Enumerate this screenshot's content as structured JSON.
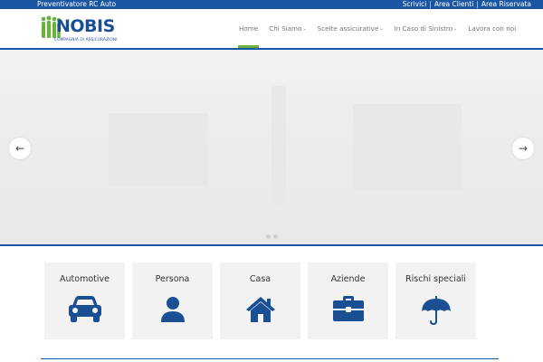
{
  "topbar": {
    "left_text": "Preventivatore RC Auto",
    "links": [
      {
        "label": "Scrivici"
      },
      {
        "label": "Area Clienti"
      },
      {
        "label": "Area Riservata"
      }
    ],
    "separator": "|"
  },
  "logo": {
    "wordmark": "NOBIS",
    "tagline": "COMPAGNIA DI ASSICURAZIONI"
  },
  "nav": {
    "items": [
      {
        "label": "Home",
        "has_dropdown": false
      },
      {
        "label": "Chi Siamo",
        "has_dropdown": true
      },
      {
        "label": "Scelte assicurative",
        "has_dropdown": true
      },
      {
        "label": "In Caso di Sinistro",
        "has_dropdown": true
      },
      {
        "label": "Lavora con noi",
        "has_dropdown": false
      }
    ],
    "caret": "⌄"
  },
  "slider": {
    "prev_arrow": "←",
    "next_arrow": "→",
    "slide_count": 2
  },
  "cards": [
    {
      "label": "Automotive",
      "icon": "car-icon"
    },
    {
      "label": "Persona",
      "icon": "person-icon"
    },
    {
      "label": "Casa",
      "icon": "house-icon"
    },
    {
      "label": "Aziende",
      "icon": "briefcase-icon"
    },
    {
      "label": "Rischi speciali",
      "icon": "umbrella-icon"
    }
  ],
  "colors": {
    "brand_blue": "#1b56a4",
    "accent_green": "#6ab23e",
    "icon_blue": "#1b4f93"
  }
}
